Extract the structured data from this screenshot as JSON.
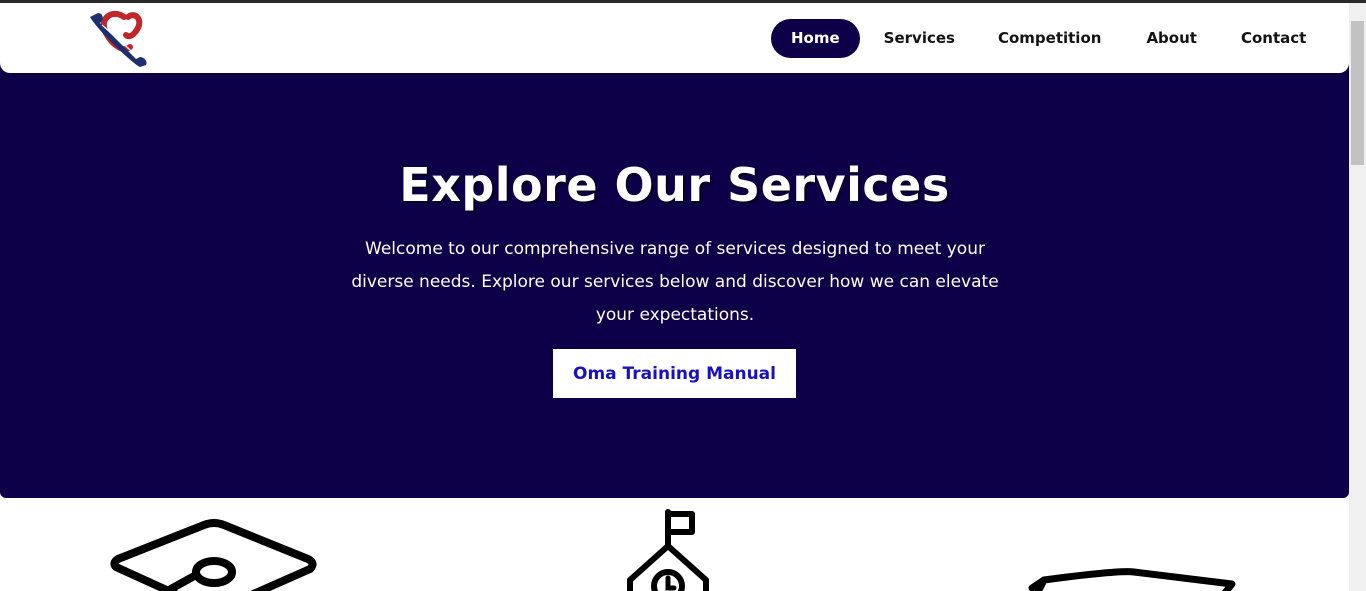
{
  "nav": {
    "items": [
      {
        "label": "Home"
      },
      {
        "label": "Services"
      },
      {
        "label": "Competition"
      },
      {
        "label": "About"
      },
      {
        "label": "Contact"
      }
    ],
    "active_index": 0
  },
  "hero": {
    "title": "Explore Our Services",
    "description": "Welcome to our comprehensive range of services designed to meet your diverse needs. Explore our services below and discover how we can elevate your expectations.",
    "button_label": "Oma Training Manual"
  },
  "icons": {
    "logo": "phone-handset-logo-icon",
    "service_1": "graduation-cap-icon",
    "service_2": "school-building-clock-icon",
    "service_3": "mortarboard-icon"
  },
  "colors": {
    "primary": "#0e0048",
    "button_text": "#1a10c0",
    "logo_red": "#c0262b",
    "logo_blue": "#1d2f6f"
  }
}
